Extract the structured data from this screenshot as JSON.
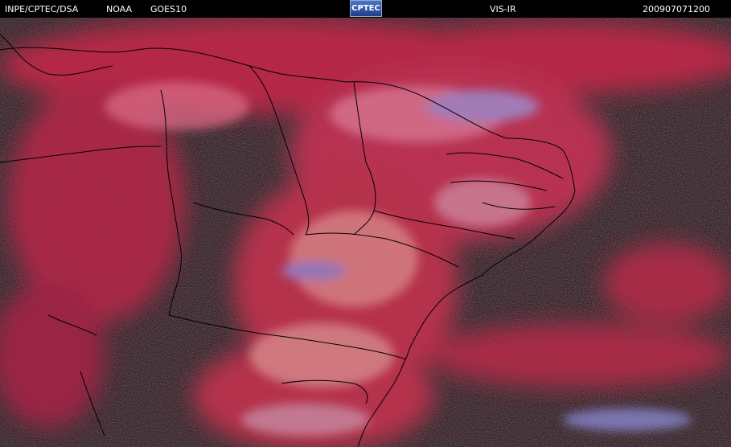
{
  "header": {
    "source": "INPE/CPTEC/DSA",
    "agency": "NOAA",
    "satellite": "GOES10",
    "logo": "CPTEC",
    "channel": "VIS-IR",
    "timestamp": "200907071200"
  },
  "colors": {
    "background": "#000000",
    "land_clear": "#2b2b2b",
    "cloud_red": "#c8284a",
    "cloud_pink": "#d85a78",
    "cloud_high": "#8c8cd8",
    "boundary": "#000000"
  },
  "icons": [
    "cptec-logo"
  ]
}
